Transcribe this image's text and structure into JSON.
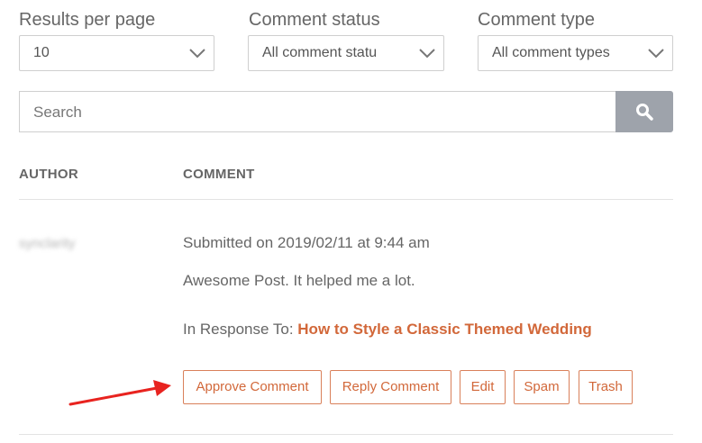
{
  "filters": {
    "results_per_page": {
      "label": "Results per page",
      "value": "10"
    },
    "comment_status": {
      "label": "Comment status",
      "value": "All comment statu"
    },
    "comment_type": {
      "label": "Comment type",
      "value": "All comment types"
    }
  },
  "search": {
    "placeholder": "Search",
    "icon": "search-icon"
  },
  "table": {
    "columns": [
      "AUTHOR",
      "COMMENT"
    ],
    "rows": [
      {
        "author": "synclarity",
        "submitted": "Submitted on 2019/02/11 at 9:44 am",
        "text": "Awesome Post. It helped me a lot.",
        "in_response_label": "In Response To: ",
        "post_title": "How to Style a Classic Themed Wedding",
        "actions": [
          "Approve Comment",
          "Reply Comment",
          "Edit",
          "Spam",
          "Trash"
        ]
      }
    ]
  },
  "colors": {
    "accent": "#d2683a",
    "search_button": "#9ea3ab",
    "annotation_arrow": "#e8231f"
  }
}
